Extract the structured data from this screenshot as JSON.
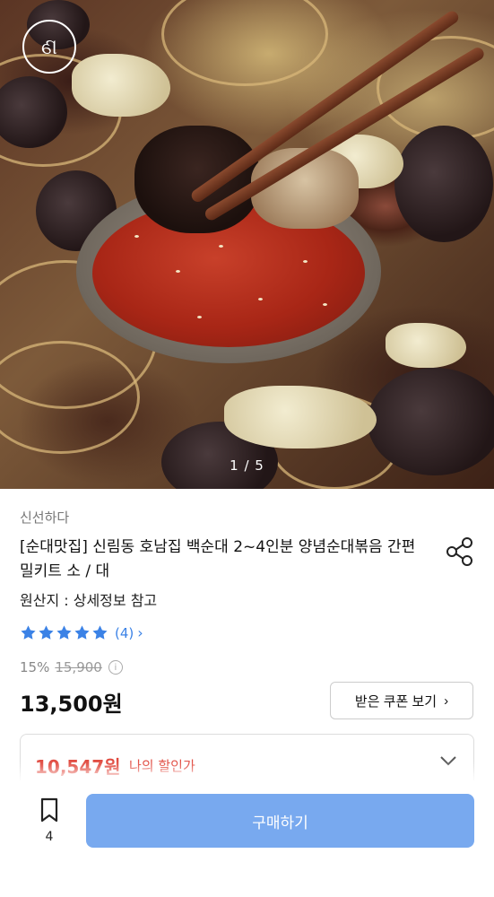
{
  "hero": {
    "page_indicator": "1 / 5"
  },
  "product": {
    "seller": "신선하다",
    "title": "[순대맛집] 신림동 호남집 백순대 2~4인분 양념순대볶음 간편 밀키트 소 / 대",
    "origin": "원산지 : 상세정보 참고",
    "rating_stars": 5,
    "review_count": "(4)",
    "discount_rate": "15%",
    "original_price": "15,900",
    "price": "13,500원"
  },
  "coupon": {
    "label": "받은 쿠폰 보기"
  },
  "my_price": {
    "amount": "10,547원",
    "label": "나의 할인가"
  },
  "bottom": {
    "bookmark_count": "4",
    "buy_label": "구매하기"
  },
  "colors": {
    "accent_blue": "#3b82e6",
    "buy_button": "#78a9ef",
    "discount_red": "#e0453a"
  },
  "icons": [
    "brand-logo-icon",
    "share-icon",
    "star-icon",
    "chevron-right-icon",
    "info-icon",
    "chevron-down-icon",
    "bookmark-icon"
  ]
}
